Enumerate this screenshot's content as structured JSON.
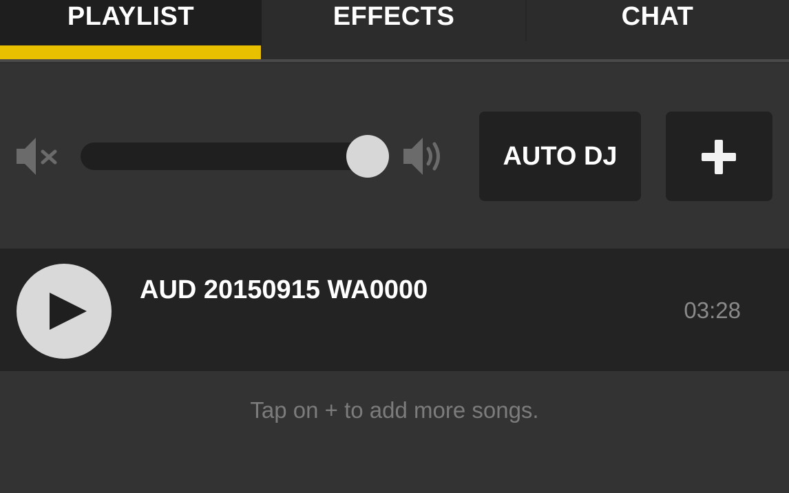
{
  "tabs": [
    {
      "label": "PLAYLIST",
      "active": true
    },
    {
      "label": "EFFECTS",
      "active": false
    },
    {
      "label": "CHAT",
      "active": false
    }
  ],
  "colors": {
    "accent": "#e8c000",
    "background": "#333333",
    "row_background": "#232323",
    "button_background": "#212121"
  },
  "volume": {
    "level_fraction": 0.95,
    "mute_icon": "speaker-muted-icon",
    "max_icon": "speaker-loud-icon"
  },
  "controls": {
    "auto_dj_label": "AUTO DJ",
    "add_icon": "plus-icon"
  },
  "playlist": [
    {
      "title": "AUD 20150915 WA0000",
      "duration": "03:28",
      "icon": "play-icon"
    }
  ],
  "hint": "Tap on + to add more songs."
}
